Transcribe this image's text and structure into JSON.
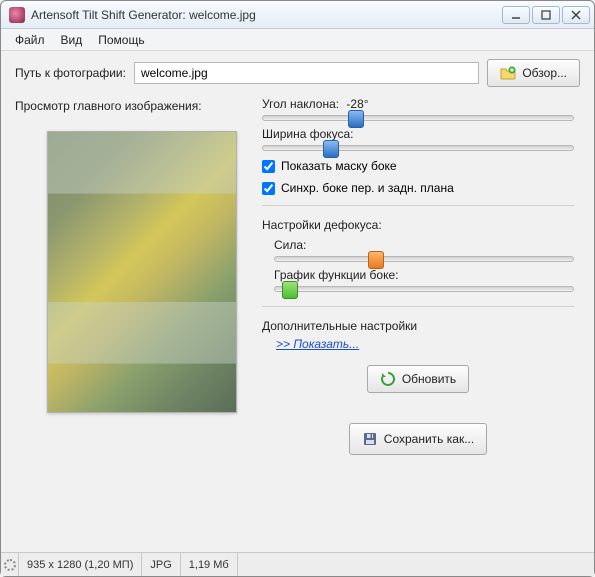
{
  "window": {
    "title": "Artensoft Tilt Shift Generator: welcome.jpg"
  },
  "menu": {
    "file": "Файл",
    "view": "Вид",
    "help": "Помощь"
  },
  "path": {
    "label": "Путь к фотографии:",
    "value": "welcome.jpg",
    "browse": "Обзор..."
  },
  "preview": {
    "label": "Просмотр главного изображения:"
  },
  "controls": {
    "angleLabel": "Угол наклона:",
    "angleValue": "-28°",
    "anglePos": 30,
    "widthLabel": "Ширина фокуса:",
    "widthPos": 22,
    "showMask": "Показать маску боке",
    "syncBokeh": "Синхр. боке пер. и задн. плана",
    "defocusLabel": "Настройки дефокуса:",
    "strengthLabel": "Сила:",
    "strengthPos": 34,
    "graphLabel": "График функции боке:",
    "graphPos": 5,
    "moreLabel": "Дополнительные настройки",
    "showMore": ">> Показать...",
    "refresh": "Обновить",
    "saveAs": "Сохранить как..."
  },
  "status": {
    "dims": "935 x 1280 (1,20 МП)",
    "format": "JPG",
    "size": "1,19 Мб"
  },
  "colors": {
    "accent": "#1a4fcc"
  }
}
